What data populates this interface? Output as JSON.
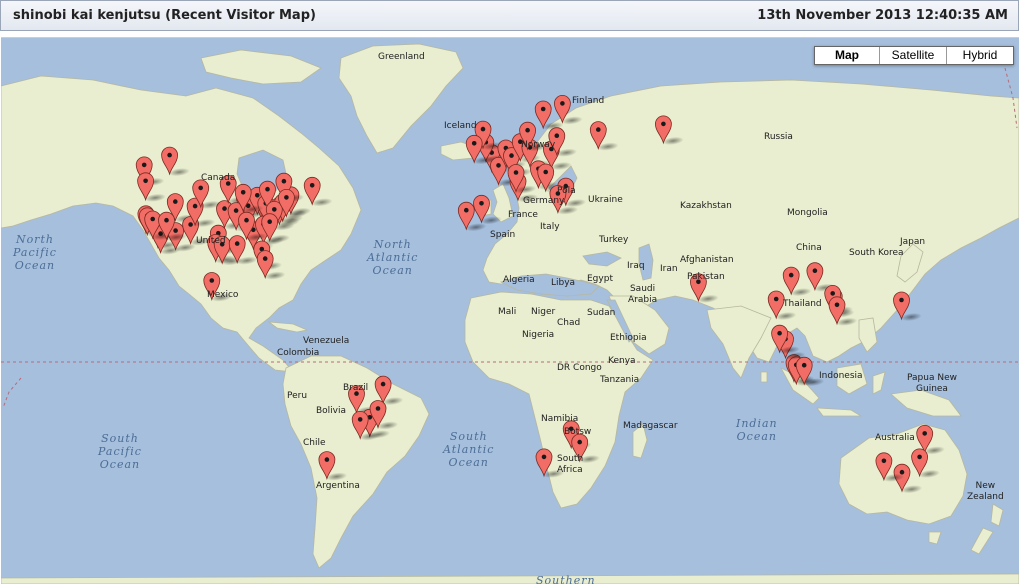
{
  "header": {
    "title": "shinobi kai kenjutsu (Recent Visitor Map)",
    "timestamp": "13th November 2013 12:40:35 AM"
  },
  "map_controls": {
    "map": "Map",
    "satellite": "Satellite",
    "hybrid": "Hybrid",
    "selected": "Map"
  },
  "colors": {
    "water": "#a5bfdd",
    "land": "#e8eecf",
    "marker": "#f26d65"
  },
  "labels": {
    "greenland": "Greenland",
    "iceland": "Iceland",
    "finland": "Finland",
    "norway": "Norway",
    "russia": "Russia",
    "canada": "Canada",
    "united_states": "United",
    "mexico": "Mexico",
    "venezuela": "Venezuela",
    "colombia": "Colombia",
    "peru": "Peru",
    "bolivia": "Bolivia",
    "brazil": "Brazil",
    "chile": "Chile",
    "argentina": "Argentina",
    "france": "France",
    "spain": "Spain",
    "italy": "Italy",
    "germany": "Germany",
    "poland": "Pola",
    "ukraine": "Ukraine",
    "turkey": "Turkey",
    "iraq": "Iraq",
    "iran": "Iran",
    "algeria": "Algeria",
    "libya": "Libya",
    "egypt": "Egypt",
    "saudi_arabia": "Saudi\nArabia",
    "mali": "Mali",
    "niger": "Niger",
    "chad": "Chad",
    "sudan": "Sudan",
    "nigeria": "Nigeria",
    "ethiopia": "Ethiopia",
    "dr_congo": "DR Congo",
    "kenya": "Kenya",
    "tanzania": "Tanzania",
    "namibia": "Namibia",
    "botswana": "Botsw",
    "south_africa": "South\nAfrica",
    "madagascar": "Madagascar",
    "kazakhstan": "Kazakhstan",
    "mongolia": "Mongolia",
    "china": "China",
    "afghanistan": "Afghanistan",
    "pakistan": "Pakistan",
    "thailand": "Thailand",
    "indonesia": "Indonesia",
    "japan": "Japan",
    "south_korea": "South Korea",
    "papua_new_guinea": "Papua New\nGuinea",
    "australia": "Australia",
    "new_zealand": "New\nZealand"
  },
  "oceans": {
    "north_pacific": "North\nPacific\nOcean",
    "north_atlantic": "North\nAtlantic\nOcean",
    "south_pacific": "South\nPacific\nOcean",
    "south_atlantic": "South\nAtlantic\nOcean",
    "indian": "Indian\nOcean",
    "southern": "Southern"
  },
  "visitor_markers": [
    {
      "lon": -123,
      "lat": 49
    },
    {
      "lon": -122.5,
      "lat": 45.6
    },
    {
      "lon": -122.4,
      "lat": 37.8
    },
    {
      "lon": -121.9,
      "lat": 37.3
    },
    {
      "lon": -118.2,
      "lat": 34.1
    },
    {
      "lon": -117.2,
      "lat": 32.7
    },
    {
      "lon": -120,
      "lat": 36.5
    },
    {
      "lon": -112,
      "lat": 40.8
    },
    {
      "lon": -111.9,
      "lat": 33.5
    },
    {
      "lon": -106.6,
      "lat": 35.1
    },
    {
      "lon": -105,
      "lat": 39.7
    },
    {
      "lon": -96.8,
      "lat": 32.8
    },
    {
      "lon": -97.7,
      "lat": 30.3
    },
    {
      "lon": -95.4,
      "lat": 29.8
    },
    {
      "lon": -90.1,
      "lat": 30
    },
    {
      "lon": -94.6,
      "lat": 39.1
    },
    {
      "lon": -93.3,
      "lat": 45
    },
    {
      "lon": -87.6,
      "lat": 41.9
    },
    {
      "lon": -86.2,
      "lat": 39.8
    },
    {
      "lon": -84.4,
      "lat": 33.7
    },
    {
      "lon": -81.7,
      "lat": 41.5
    },
    {
      "lon": -83,
      "lat": 42.3
    },
    {
      "lon": -80,
      "lat": 40.4
    },
    {
      "lon": -79.4,
      "lat": 43.7
    },
    {
      "lon": -75.2,
      "lat": 39.9
    },
    {
      "lon": -74,
      "lat": 40.7
    },
    {
      "lon": -71.1,
      "lat": 42.4
    },
    {
      "lon": -77,
      "lat": 38.9
    },
    {
      "lon": -80.8,
      "lat": 35.2
    },
    {
      "lon": -81.4,
      "lat": 28.5
    },
    {
      "lon": -80.2,
      "lat": 25.8
    },
    {
      "lon": -73.6,
      "lat": 45.5
    },
    {
      "lon": -63.6,
      "lat": 44.6
    },
    {
      "lon": -114,
      "lat": 51
    },
    {
      "lon": -99.1,
      "lat": 19.4
    },
    {
      "lon": -90.5,
      "lat": 38.6
    },
    {
      "lon": -86.8,
      "lat": 36.2
    },
    {
      "lon": -78.6,
      "lat": 35.8
    },
    {
      "lon": -88,
      "lat": 43
    },
    {
      "lon": -72.7,
      "lat": 41.8
    },
    {
      "lon": -103,
      "lat": 44
    },
    {
      "lon": -115.1,
      "lat": 36.2
    },
    {
      "lon": -47.9,
      "lat": -15.8
    },
    {
      "lon": -43.2,
      "lat": -22.9
    },
    {
      "lon": -46.6,
      "lat": -23.5
    },
    {
      "lon": -38.5,
      "lat": -12.9
    },
    {
      "lon": -40.3,
      "lat": -20.3
    },
    {
      "lon": -58.4,
      "lat": -34.6
    },
    {
      "lon": -0.1,
      "lat": 51.5
    },
    {
      "lon": -2.2,
      "lat": 53.5
    },
    {
      "lon": -3.2,
      "lat": 55.9
    },
    {
      "lon": -6.3,
      "lat": 53.3
    },
    {
      "lon": 2.3,
      "lat": 48.9
    },
    {
      "lon": 4.9,
      "lat": 52.4
    },
    {
      "lon": 6.9,
      "lat": 50.9
    },
    {
      "lon": 10,
      "lat": 53.6
    },
    {
      "lon": 13.4,
      "lat": 52.5
    },
    {
      "lon": 12.6,
      "lat": 55.7
    },
    {
      "lon": 18.1,
      "lat": 59.3
    },
    {
      "lon": 24.9,
      "lat": 60.2
    },
    {
      "lon": 21,
      "lat": 52.2
    },
    {
      "lon": 16.4,
      "lat": 48.2
    },
    {
      "lon": 19,
      "lat": 47.5
    },
    {
      "lon": 26.1,
      "lat": 44.4
    },
    {
      "lon": 23.3,
      "lat": 42.7
    },
    {
      "lon": 9.2,
      "lat": 45.5
    },
    {
      "lon": 8.5,
      "lat": 47.4
    },
    {
      "lon": -3.7,
      "lat": 40.4
    },
    {
      "lon": -9.1,
      "lat": 38.7
    },
    {
      "lon": 22.9,
      "lat": 54.7
    },
    {
      "lon": 37.6,
      "lat": 55.8
    },
    {
      "lon": 60.6,
      "lat": 56.8
    },
    {
      "lon": 73,
      "lat": 19
    },
    {
      "lon": 100.5,
      "lat": 13.8
    },
    {
      "lon": 114.2,
      "lat": 22.3
    },
    {
      "lon": 121,
      "lat": 14.6
    },
    {
      "lon": 120.5,
      "lat": 15.5
    },
    {
      "lon": 122,
      "lat": 12
    },
    {
      "lon": 144.8,
      "lat": 13.5
    },
    {
      "lon": 106.8,
      "lat": -6.2
    },
    {
      "lon": 107.6,
      "lat": -6.9
    },
    {
      "lon": 110.4,
      "lat": -7
    },
    {
      "lon": 105.8,
      "lat": 21
    },
    {
      "lon": 103.8,
      "lat": 1.3
    },
    {
      "lon": 101.7,
      "lat": 3.1
    },
    {
      "lon": 153,
      "lat": -27.5
    },
    {
      "lon": 151.2,
      "lat": -33.9
    },
    {
      "lon": 145,
      "lat": -37.8
    },
    {
      "lon": 138.6,
      "lat": -34.9
    },
    {
      "lon": 28,
      "lat": -26.2
    },
    {
      "lon": 31,
      "lat": -29.9
    },
    {
      "lon": 18.4,
      "lat": -33.9
    }
  ]
}
